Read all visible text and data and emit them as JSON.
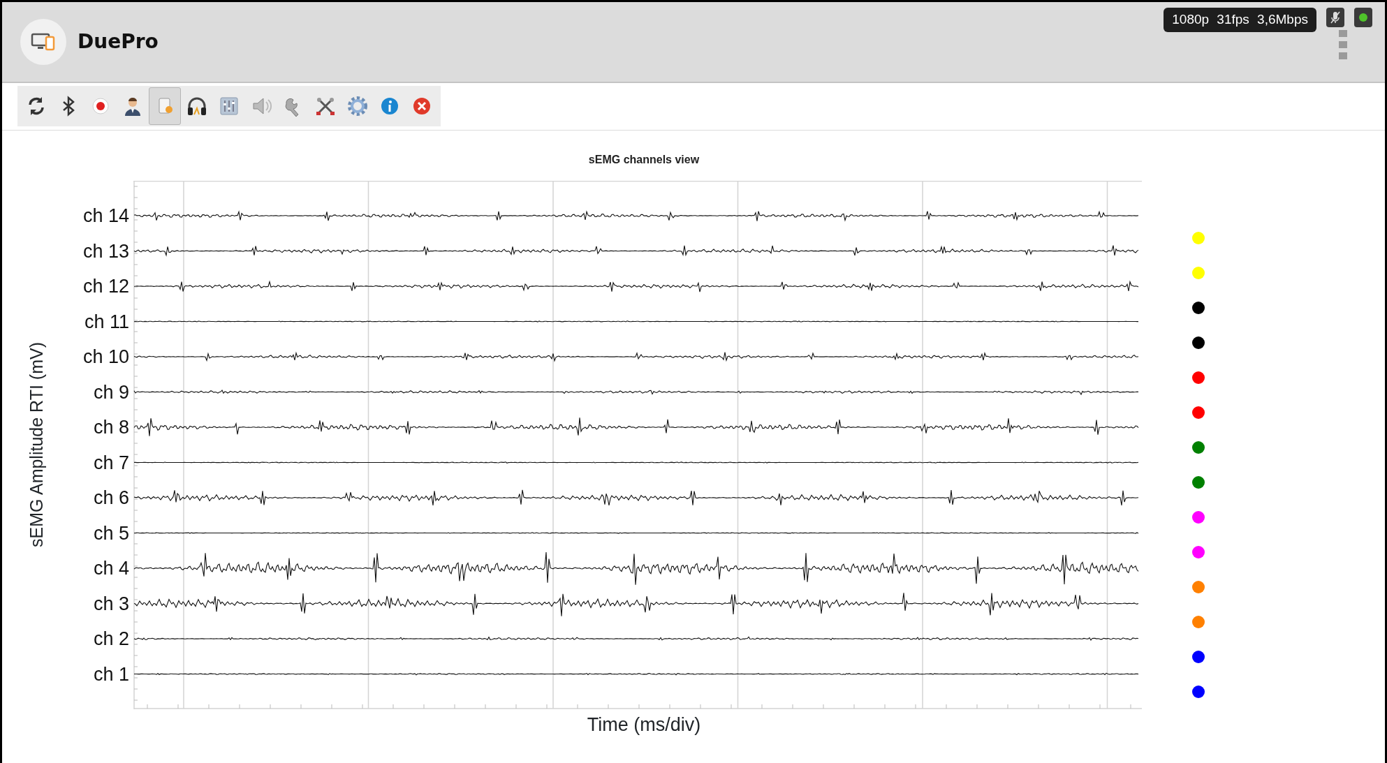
{
  "app": {
    "title": "DuePro"
  },
  "status": {
    "stream": "1080p 31fps 3,6Mbps"
  },
  "toolbar": [
    {
      "selected": false
    },
    {
      "selected": false
    },
    {
      "selected": false
    },
    {
      "selected": false
    },
    {
      "selected": true
    },
    {
      "selected": false
    },
    {
      "selected": false
    },
    {
      "selected": false
    },
    {
      "selected": false
    },
    {
      "selected": false
    },
    {
      "selected": false
    },
    {
      "selected": false
    },
    {
      "selected": false
    }
  ],
  "chart": {
    "title": "sEMG channels view",
    "ylabel": "sEMG Amplitude RTI (mV)",
    "xlabel": "Time (ms/div)",
    "channels": [
      {
        "label": "ch 14"
      },
      {
        "label": "ch 13"
      },
      {
        "label": "ch 12"
      },
      {
        "label": "ch 11"
      },
      {
        "label": "ch 10"
      },
      {
        "label": "ch 9"
      },
      {
        "label": "ch 8"
      },
      {
        "label": "ch 7"
      },
      {
        "label": "ch 6"
      },
      {
        "label": "ch 5"
      },
      {
        "label": "ch 4"
      },
      {
        "label": "ch 3"
      },
      {
        "label": "ch 2"
      },
      {
        "label": "ch 1"
      }
    ]
  },
  "legend": [
    {
      "color": "#ffff00"
    },
    {
      "color": "#ffff00"
    },
    {
      "color": "#000000"
    },
    {
      "color": "#000000"
    },
    {
      "color": "#ff0000"
    },
    {
      "color": "#ff0000"
    },
    {
      "color": "#008000"
    },
    {
      "color": "#008000"
    },
    {
      "color": "#ff00ff"
    },
    {
      "color": "#ff00ff"
    },
    {
      "color": "#ff8000"
    },
    {
      "color": "#ff8000"
    },
    {
      "color": "#0000ff"
    },
    {
      "color": "#0000ff"
    }
  ]
}
